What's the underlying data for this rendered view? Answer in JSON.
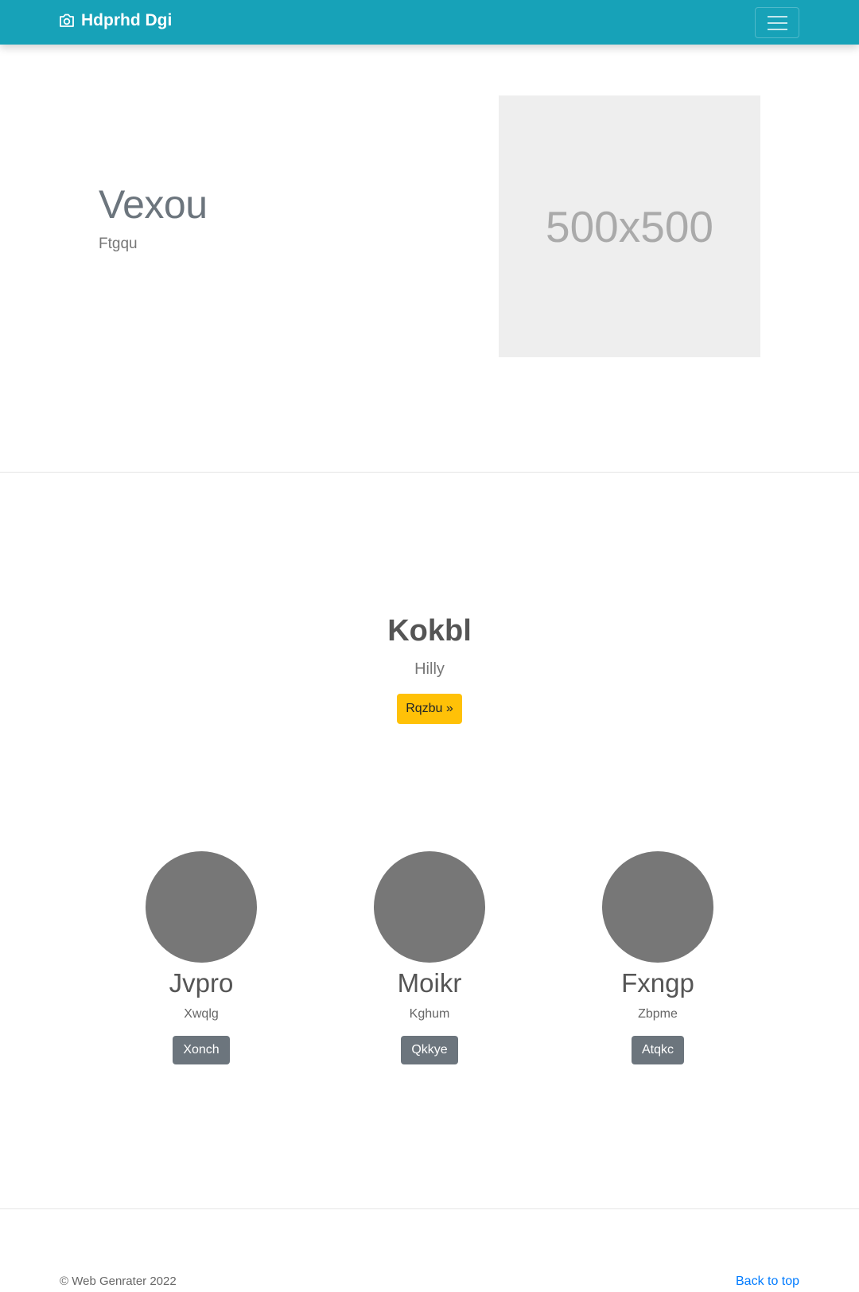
{
  "navbar": {
    "brand": "Hdprhd Dgi",
    "brand_icon": "camera-icon",
    "toggler_icon": "hamburger-icon"
  },
  "hero": {
    "title": "Vexou",
    "subtitle": "Ftgqu",
    "image_placeholder": "500x500"
  },
  "feature": {
    "title": "Kokbl",
    "subtitle": "Hilly",
    "button_label": "Rqzbu »"
  },
  "cards": [
    {
      "title": "Jvpro",
      "subtitle": "Xwqlg",
      "button": "Xonch"
    },
    {
      "title": "Moikr",
      "subtitle": "Kghum",
      "button": "Qkkye"
    },
    {
      "title": "Fxngp",
      "subtitle": "Zbpme",
      "button": "Atqkc"
    }
  ],
  "footer": {
    "copyright": "© Web Genrater 2022",
    "back_to_top": "Back to top"
  },
  "colors": {
    "navbar": "#17a2b8",
    "cta": "#ffc107",
    "secondary": "#6c757d",
    "link": "#007bff",
    "avatar": "#777777"
  }
}
